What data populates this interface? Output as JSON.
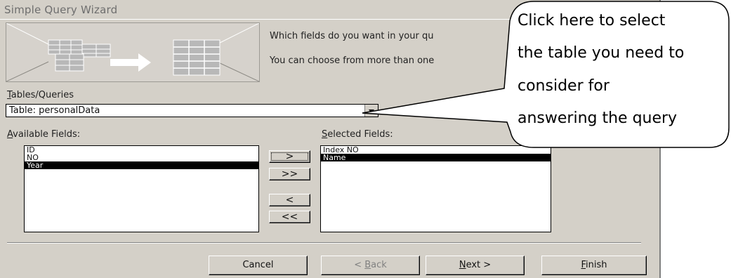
{
  "window": {
    "title": "Simple Query Wizard"
  },
  "prompt": {
    "line1": "Which fields do you want in your qu",
    "line2": "You can choose from more than one"
  },
  "tables": {
    "label_hotkey": "T",
    "label_rest": "ables/Queries",
    "selected": "Table: personalData"
  },
  "available": {
    "label_hotkey": "A",
    "label_rest": "vailable Fields:",
    "items": [
      "ID",
      "NO",
      "Year"
    ]
  },
  "selected_fields": {
    "label_hotkey": "S",
    "label_rest": "elected Fields:",
    "items": [
      "Index NO",
      "Name"
    ]
  },
  "move_buttons": {
    "add": ">",
    "add_all": ">>",
    "remove": "<",
    "remove_all": "<<"
  },
  "buttons": {
    "cancel": "Cancel",
    "back_pre": "< ",
    "back_hotkey": "B",
    "back_rest": "ack",
    "next_hotkey": "N",
    "next_rest": "ext >",
    "finish_hotkey": "F",
    "finish_rest": "inish"
  },
  "callout": {
    "lines": [
      "Click here to select",
      "the table you need to",
      "consider for",
      "answering the query"
    ]
  }
}
